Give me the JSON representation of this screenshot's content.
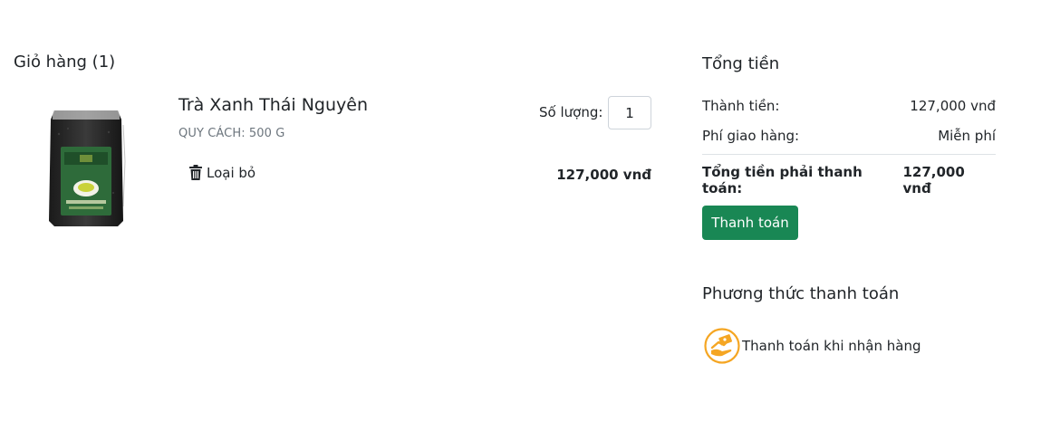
{
  "cart": {
    "title": "Giỏ hàng (1)",
    "items": [
      {
        "name": "Trà Xanh Thái Nguyên",
        "spec": "QUY CÁCH: 500 G",
        "remove_label": "Loại bỏ",
        "quantity_label": "Số lượng:",
        "quantity": "1",
        "price": "127,000 vnđ",
        "image_icon": "tea-package-image"
      }
    ]
  },
  "summary": {
    "title": "Tổng tiền",
    "subtotal_label": "Thành tiền:",
    "subtotal_value": "127,000 vnđ",
    "shipping_label": "Phí giao hàng:",
    "shipping_value": "Miễn phí",
    "total_label": "Tổng tiền phải thanh toán:",
    "total_value": "127,000 vnđ",
    "checkout_label": "Thanh toán"
  },
  "payment": {
    "title": "Phương thức thanh toán",
    "option_label": "Thanh toán khi nhận hàng",
    "option_icon": "cash-on-delivery-icon"
  },
  "colors": {
    "accent_green": "#198754",
    "text": "#212529",
    "muted": "#6c757d",
    "icon_orange": "#f5a623"
  }
}
